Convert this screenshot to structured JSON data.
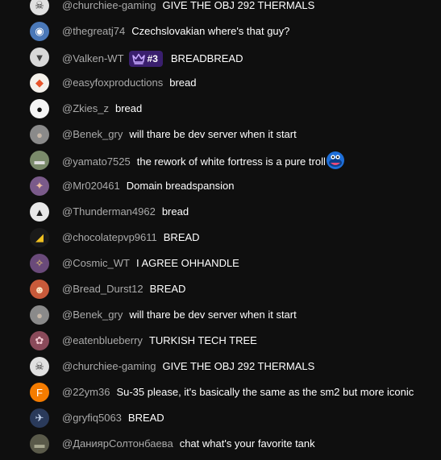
{
  "chat": {
    "messages": [
      {
        "author": "@churchiee-gaming",
        "text": "GIVE THE OBJ 292 THERMALS",
        "avatar": {
          "icon": "skull-avatar",
          "color": "#e0e0e0",
          "glyph": "☠"
        }
      },
      {
        "author": "@thegreatj74",
        "text": "Czechslovakian where's that guy?",
        "avatar": {
          "icon": "cartoon-avatar",
          "color": "#4a78b8",
          "glyph": "◉"
        }
      },
      {
        "author": "@Valken-WT",
        "text": "BREADBREAD",
        "badge": "#3",
        "avatar": {
          "icon": "wolf-avatar",
          "color": "#d8d8d8",
          "glyph": "▼"
        }
      },
      {
        "author": "@easyfoxproductions",
        "text": "bread",
        "avatar": {
          "icon": "fox-avatar",
          "color": "#f4f0ea",
          "glyph": "◆"
        }
      },
      {
        "author": "@Zkies_z",
        "text": "bread",
        "avatar": {
          "icon": "cat-avatar",
          "color": "#f5f5f5",
          "glyph": "●"
        }
      },
      {
        "author": "@Benek_gry",
        "text": "will thare be dev server when it start",
        "avatar": {
          "icon": "face-avatar",
          "color": "#8a8a8a",
          "glyph": "●"
        }
      },
      {
        "author": "@yamato7525",
        "text": "the rework of white fortress is a pure troll",
        "emoji": "blue-bird-emoji",
        "avatar": {
          "icon": "ship-avatar",
          "color": "#7a8a6a",
          "glyph": "▬"
        }
      },
      {
        "author": "@Mr020461",
        "text": "Domain breadspansion",
        "avatar": {
          "icon": "art-avatar",
          "color": "#7a5a8a",
          "glyph": "✦"
        }
      },
      {
        "author": "@Thunderman4962",
        "text": "bread",
        "avatar": {
          "icon": "tank-avatar",
          "color": "#e8e8e8",
          "glyph": "▲"
        }
      },
      {
        "author": "@chocolatepvp9611",
        "text": "BREAD",
        "avatar": {
          "icon": "logo-avatar",
          "color": "#1a1a1a",
          "glyph": "◢"
        }
      },
      {
        "author": "@Cosmic_WT",
        "text": "I AGREE OHHANDLE",
        "avatar": {
          "icon": "anime-avatar",
          "color": "#6a4a7a",
          "glyph": "✧"
        }
      },
      {
        "author": "@Bread_Durst12",
        "text": "BREAD",
        "avatar": {
          "icon": "cartoon-face-avatar",
          "color": "#c85a3a",
          "glyph": "☻"
        }
      },
      {
        "author": "@Benek_gry",
        "text": "will thare be dev server when it start",
        "avatar": {
          "icon": "face-avatar",
          "color": "#8a8a8a",
          "glyph": "●"
        }
      },
      {
        "author": "@eatenblueberry",
        "text": "TURKISH TECH TREE",
        "avatar": {
          "icon": "flower-avatar",
          "color": "#8a4a5a",
          "glyph": "✿"
        }
      },
      {
        "author": "@churchiee-gaming",
        "text": "GIVE THE OBJ 292 THERMALS",
        "avatar": {
          "icon": "skull-avatar",
          "color": "#e0e0e0",
          "glyph": "☠"
        }
      },
      {
        "author": "@22ym36",
        "text": "Su-35 please, it's basically the same as the sm2 but more iconic",
        "avatar": {
          "icon": "letter-avatar",
          "color": "#f57c00",
          "glyph": "F"
        }
      },
      {
        "author": "@gryfiq5063",
        "text": "BREAD",
        "avatar": {
          "icon": "jet-avatar",
          "color": "#2a3a5a",
          "glyph": "✈"
        }
      },
      {
        "author": "@ДаниярСолтонбаева",
        "text": "chat what's your favorite tank",
        "avatar": {
          "icon": "tank-photo-avatar",
          "color": "#5a5a4a",
          "glyph": "▬"
        }
      }
    ]
  },
  "colors": {
    "background": "#0f0f0f",
    "author": "#aaaaaa",
    "message": "#ffffff",
    "badge_bg": "#3a1f6e",
    "badge_icon": "#c7a8ff"
  }
}
